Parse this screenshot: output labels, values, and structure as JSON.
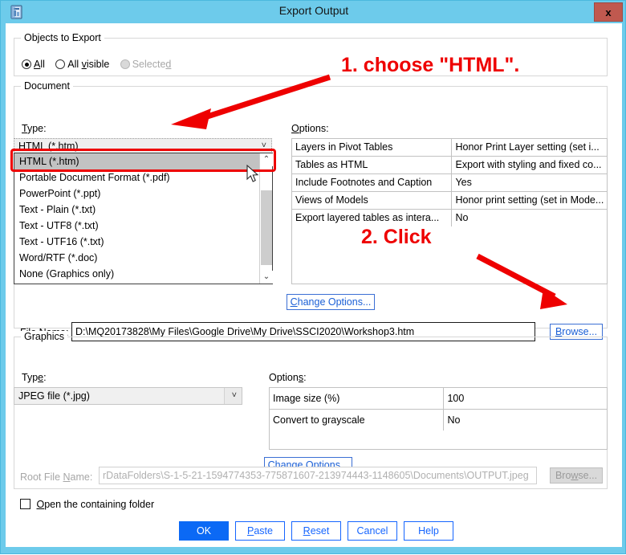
{
  "window": {
    "title": "Export Output",
    "icon": "spss-output-icon",
    "close_label": "x"
  },
  "objects_group": {
    "title": "Objects to Export",
    "options": [
      {
        "label": "All",
        "mnemonic": "A",
        "checked": true,
        "disabled": false
      },
      {
        "label": "All visible",
        "mnemonic": "v",
        "checked": false,
        "disabled": false
      },
      {
        "label": "Selected",
        "mnemonic": "d",
        "checked": false,
        "disabled": true
      }
    ]
  },
  "document_group": {
    "title": "Document",
    "type_label": "Type:",
    "type_mnemonic": "T",
    "selected_type": "HTML (*.htm)",
    "type_items": [
      "HTML (*.htm)",
      "Portable Document Format (*.pdf)",
      "PowerPoint (*.ppt)",
      "Text - Plain (*.txt)",
      "Text - UTF8 (*.txt)",
      "Text - UTF16 (*.txt)",
      "Word/RTF (*.doc)",
      "None (Graphics only)"
    ],
    "options_label": "Options:",
    "options_mnemonic": "O",
    "options_rows": [
      {
        "key": "Layers in Pivot Tables",
        "value": "Honor Print Layer setting (set i..."
      },
      {
        "key": "Tables as HTML",
        "value": "Export with styling and fixed co..."
      },
      {
        "key": "Include Footnotes and Caption",
        "value": "Yes"
      },
      {
        "key": "Views of Models",
        "value": "Honor print setting (set in Mode..."
      },
      {
        "key": "Export layered tables as intera...",
        "value": "No"
      }
    ],
    "change_options_label": "Change Options...",
    "change_options_mnemonic": "C",
    "file_name_label": "File Name:",
    "file_name_mnemonic": "F",
    "file_name_value": "D:\\MQ20173828\\My Files\\Google Drive\\My Drive\\SSCI2020\\Workshop3.htm",
    "browse_label": "Browse...",
    "browse_mnemonic": "B"
  },
  "graphics_group": {
    "title": "Graphics",
    "type_label": "Type:",
    "type_mnemonic": "e",
    "selected_type": "JPEG file (*.jpg)",
    "options_label": "Options:",
    "options_mnemonic": "s",
    "options_rows": [
      {
        "key": "Image size (%)",
        "value": "100"
      },
      {
        "key": "Convert to grayscale",
        "value": "No"
      }
    ],
    "change_options_label": "Change Options...",
    "change_options_mnemonic": "h"
  },
  "root_file": {
    "label": "Root File Name:",
    "mnemonic": "N",
    "value": "rDataFolders\\S-1-5-21-1594774353-775871607-213974443-1148605\\Documents\\OUTPUT.jpeg",
    "browse_label": "Browse...",
    "browse_mnemonic": "w",
    "disabled": true
  },
  "open_folder": {
    "label": "Open the containing folder",
    "mnemonic": "O",
    "checked": false
  },
  "buttons": [
    {
      "label": "OK",
      "mnemonic": "",
      "primary": true
    },
    {
      "label": "Paste",
      "mnemonic": "P",
      "primary": false
    },
    {
      "label": "Reset",
      "mnemonic": "R",
      "primary": false
    },
    {
      "label": "Cancel",
      "mnemonic": "",
      "primary": false
    },
    {
      "label": "Help",
      "mnemonic": "",
      "primary": false
    }
  ],
  "annotations": [
    {
      "text": "1. choose \"HTML\".",
      "color": "#ee0000"
    },
    {
      "text": "2. Click",
      "color": "#ee0000"
    }
  ],
  "colors": {
    "titlebar": "#6dcbeb",
    "close_button": "#c0594f",
    "primary_button": "#0b69f5",
    "link_blue": "#1565ff",
    "annotation_red": "#ee0000",
    "highlight_red": "#ee0000",
    "selection_gray": "#c2c2c2"
  }
}
